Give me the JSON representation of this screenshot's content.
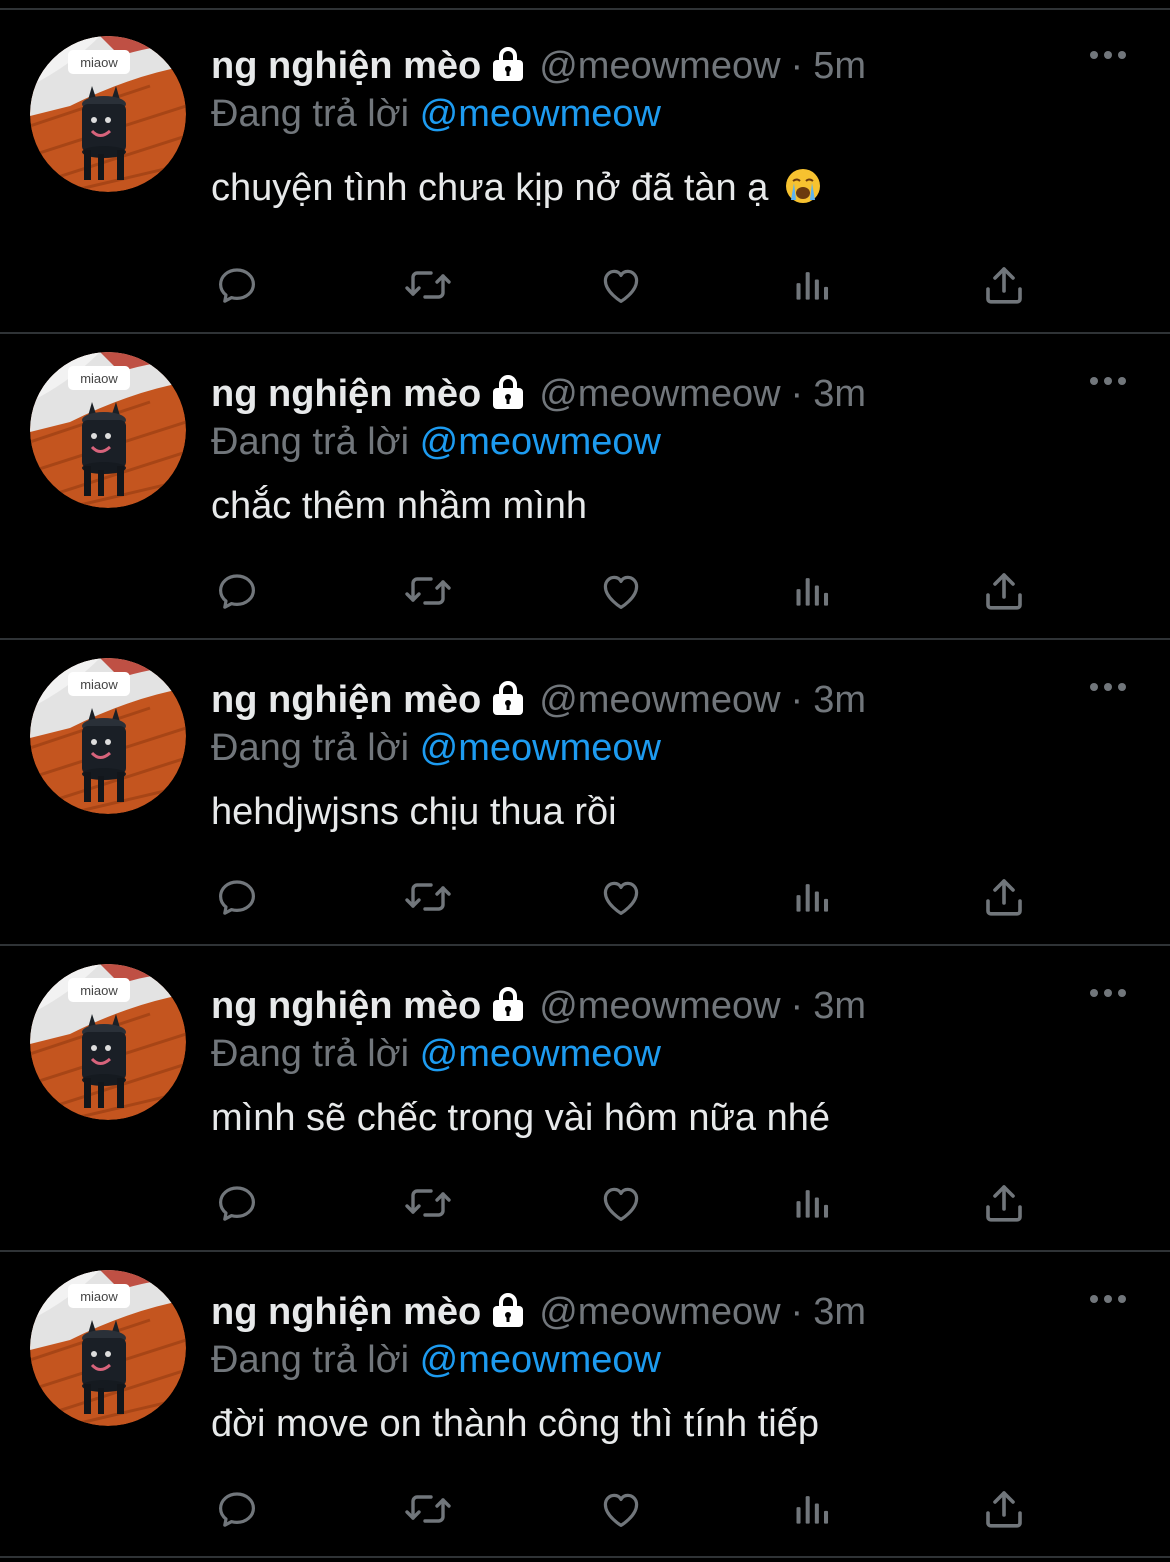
{
  "colors": {
    "background": "#000000",
    "text": "#e7e9ea",
    "muted": "#71767b",
    "link": "#1d9bf0",
    "divider": "#2f3336"
  },
  "tweets": [
    {
      "name": "ng nghiện mèo",
      "handle": "@meowmeow",
      "separator": "·",
      "time": "5m",
      "reply_prefix": "Đang trả lời",
      "reply_to": "@meowmeow",
      "text": "chuyện tình chưa kịp nở đã tàn ạ",
      "emoji": "loudly-crying-face",
      "avatar_label": "miaow"
    },
    {
      "name": "ng nghiện mèo",
      "handle": "@meowmeow",
      "separator": "·",
      "time": "3m",
      "reply_prefix": "Đang trả lời",
      "reply_to": "@meowmeow",
      "text": "chắc thêm nhầm mình",
      "avatar_label": "miaow"
    },
    {
      "name": "ng nghiện mèo",
      "handle": "@meowmeow",
      "separator": "·",
      "time": "3m",
      "reply_prefix": "Đang trả lời",
      "reply_to": "@meowmeow",
      "text": "hehdjwjsns chịu thua rồi",
      "avatar_label": "miaow"
    },
    {
      "name": "ng nghiện mèo",
      "handle": "@meowmeow",
      "separator": "·",
      "time": "3m",
      "reply_prefix": "Đang trả lời",
      "reply_to": "@meowmeow",
      "text": "mình sẽ chếc trong vài hôm nữa nhé",
      "avatar_label": "miaow"
    },
    {
      "name": "ng nghiện mèo",
      "handle": "@meowmeow",
      "separator": "·",
      "time": "3m",
      "reply_prefix": "Đang trả lời",
      "reply_to": "@meowmeow",
      "text": "đời move on thành công thì tính tiếp",
      "avatar_label": "miaow"
    }
  ],
  "action_icons": [
    "reply-icon",
    "retweet-icon",
    "like-icon",
    "views-icon",
    "share-icon"
  ]
}
